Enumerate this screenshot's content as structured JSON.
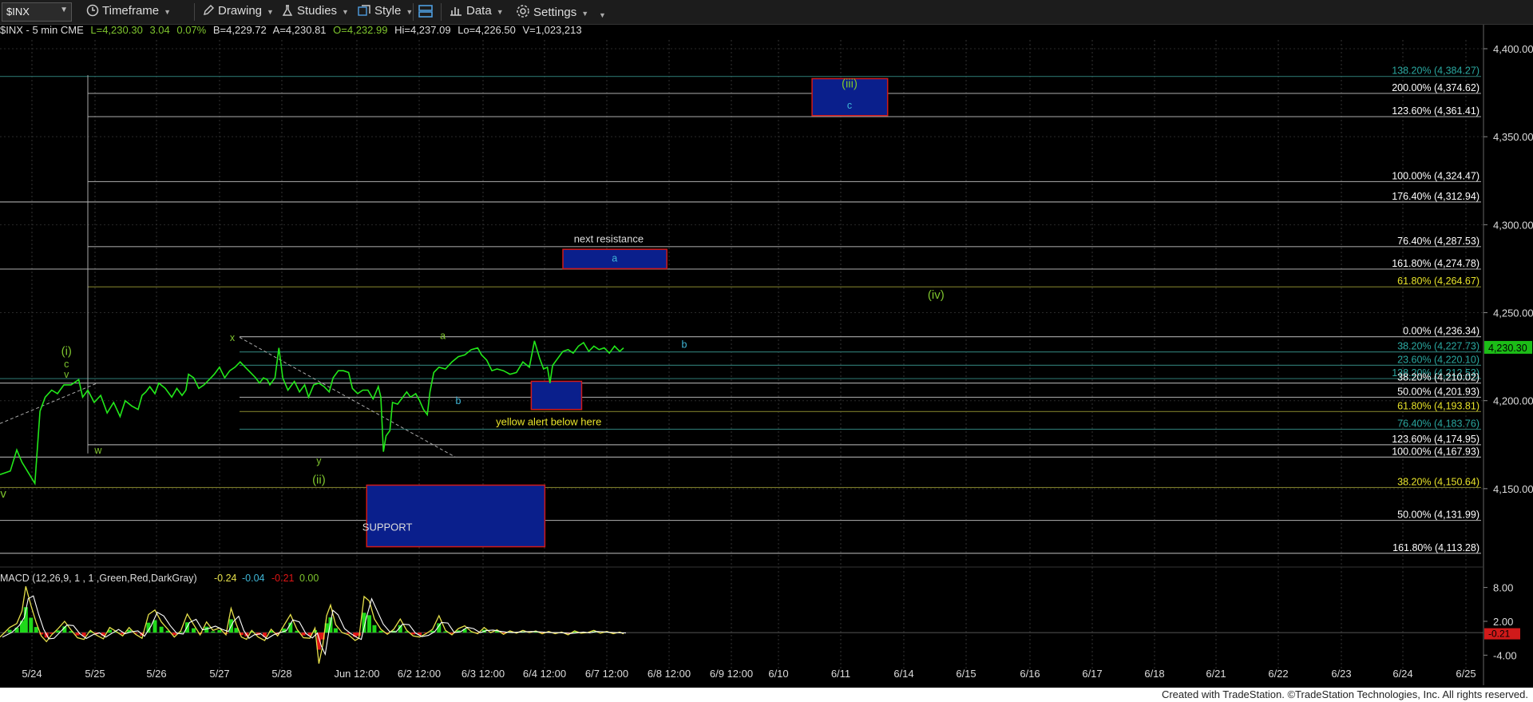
{
  "toolbar": {
    "symbol": "$INX",
    "timeframe": "Timeframe",
    "drawing": "Drawing",
    "studies": "Studies",
    "style": "Style",
    "data": "Data",
    "settings": "Settings"
  },
  "info": {
    "title": "$INX - 5 min  CME",
    "last": "L=4,230.30",
    "chg": "3.04",
    "pct": "0.07%",
    "bid": "B=4,229.72",
    "ask": "A=4,230.81",
    "open": "O=4,232.99",
    "high": "Hi=4,237.09",
    "low": "Lo=4,226.50",
    "vol": "V=1,023,213"
  },
  "colors": {
    "price": "#22e81a",
    "macd": "#e6e04a",
    "signal": "#ffffff",
    "hist_pos": "#1fd81a",
    "hist_neg": "#e01515",
    "box_fill": "#0a1f8c",
    "box_border": "#d01a1a",
    "label_green": "#7ec42e",
    "label_blue": "#3fb7d8",
    "label_yellow": "#e8e42a"
  },
  "chart_data": {
    "type": "line",
    "instrument": "$INX",
    "interval": "5 min",
    "y_ticks": [
      "4,400.00",
      "4,350.00",
      "4,300.00",
      "4,250.00",
      "4,200.00",
      "4,150.00"
    ],
    "ylim": [
      4110,
      4405
    ],
    "current_price": "4,230.30",
    "x_ticks": [
      "5/24",
      "5/25",
      "5/26",
      "5/27",
      "5/28",
      "Jun 12:00",
      "6/2 12:00",
      "6/3 12:00",
      "6/4 12:00",
      "6/7 12:00",
      "6/8 12:00",
      "6/9 12:00",
      "6/10",
      "6/11",
      "6/14",
      "6/15",
      "6/16",
      "6/17",
      "6/18",
      "6/21",
      "6/22",
      "6/23",
      "6/24",
      "6/25"
    ],
    "price_series": [
      [
        0.0,
        4158
      ],
      [
        1.6,
        4160
      ],
      [
        2.6,
        4172
      ],
      [
        3.4,
        4165
      ],
      [
        5.4,
        4153
      ],
      [
        6.2,
        4194
      ],
      [
        7.0,
        4202
      ],
      [
        8.0,
        4206
      ],
      [
        8.9,
        4204
      ],
      [
        9.9,
        4209
      ],
      [
        11.0,
        4209
      ],
      [
        12.2,
        4212
      ],
      [
        12.8,
        4202
      ],
      [
        13.6,
        4206
      ],
      [
        14.6,
        4199
      ],
      [
        15.6,
        4203
      ],
      [
        16.6,
        4193
      ],
      [
        17.6,
        4199
      ],
      [
        18.6,
        4191
      ],
      [
        19.4,
        4200
      ],
      [
        20.4,
        4197
      ],
      [
        21.4,
        4195
      ],
      [
        22.0,
        4203
      ],
      [
        22.6,
        4205
      ],
      [
        23.2,
        4208
      ],
      [
        24.0,
        4204
      ],
      [
        24.6,
        4210
      ],
      [
        25.6,
        4207
      ],
      [
        26.6,
        4202
      ],
      [
        27.4,
        4207
      ],
      [
        28.2,
        4203
      ],
      [
        28.8,
        4206
      ],
      [
        29.2,
        4215
      ],
      [
        30.0,
        4213
      ],
      [
        30.8,
        4207
      ],
      [
        31.6,
        4209
      ],
      [
        32.4,
        4212
      ],
      [
        33.2,
        4215
      ],
      [
        34.0,
        4219
      ],
      [
        34.8,
        4213
      ],
      [
        35.6,
        4217
      ],
      [
        36.4,
        4219
      ],
      [
        37.2,
        4222
      ],
      [
        38.0,
        4219
      ],
      [
        38.8,
        4216
      ],
      [
        39.6,
        4213
      ],
      [
        40.2,
        4210
      ],
      [
        40.8,
        4213
      ],
      [
        41.4,
        4212
      ],
      [
        41.8,
        4209
      ],
      [
        42.6,
        4213
      ],
      [
        43.2,
        4230
      ],
      [
        43.8,
        4213
      ],
      [
        44.6,
        4206
      ],
      [
        45.6,
        4211
      ],
      [
        46.4,
        4205
      ],
      [
        47.2,
        4209
      ],
      [
        47.8,
        4202
      ],
      [
        48.6,
        4209
      ],
      [
        49.4,
        4210
      ],
      [
        50.2,
        4208
      ],
      [
        51.0,
        4205
      ],
      [
        51.6,
        4213
      ],
      [
        52.4,
        4217
      ],
      [
        53.2,
        4217
      ],
      [
        54.0,
        4216
      ],
      [
        54.6,
        4207
      ],
      [
        55.4,
        4204
      ],
      [
        56.2,
        4206
      ],
      [
        57.0,
        4206
      ],
      [
        57.8,
        4201
      ],
      [
        58.6,
        4208
      ],
      [
        59.0,
        4202
      ],
      [
        59.4,
        4171
      ],
      [
        59.8,
        4180
      ],
      [
        60.4,
        4183
      ],
      [
        60.8,
        4199
      ],
      [
        61.6,
        4198
      ],
      [
        62.4,
        4202
      ],
      [
        63.0,
        4205
      ],
      [
        63.6,
        4202
      ],
      [
        64.4,
        4204
      ],
      [
        65.0,
        4200
      ],
      [
        65.6,
        4195
      ],
      [
        66.2,
        4192
      ],
      [
        66.6,
        4205
      ],
      [
        67.2,
        4216
      ],
      [
        68.0,
        4219
      ],
      [
        69.0,
        4218
      ],
      [
        70.0,
        4222
      ],
      [
        71.0,
        4225
      ],
      [
        72.0,
        4226
      ],
      [
        73.0,
        4229
      ],
      [
        74.0,
        4230
      ],
      [
        74.6,
        4226
      ],
      [
        75.4,
        4223
      ],
      [
        76.2,
        4217
      ],
      [
        77.0,
        4218
      ],
      [
        78.0,
        4217
      ],
      [
        79.0,
        4215
      ],
      [
        80.0,
        4216
      ],
      [
        81.0,
        4222
      ],
      [
        82.0,
        4219
      ],
      [
        82.8,
        4234
      ],
      [
        83.6,
        4224
      ],
      [
        84.2,
        4218
      ],
      [
        84.8,
        4219
      ],
      [
        85.2,
        4210
      ],
      [
        85.6,
        4220
      ],
      [
        86.4,
        4224
      ],
      [
        87.2,
        4228
      ],
      [
        88.0,
        4229
      ],
      [
        88.8,
        4227
      ],
      [
        89.6,
        4231
      ],
      [
        90.4,
        4233
      ],
      [
        91.2,
        4228
      ],
      [
        92.0,
        4231
      ],
      [
        92.8,
        4229
      ],
      [
        93.6,
        4230
      ],
      [
        94.4,
        4227
      ],
      [
        95.2,
        4231
      ],
      [
        96.0,
        4228
      ],
      [
        96.6,
        4230
      ]
    ],
    "fib_levels": [
      {
        "label": "138.20% (4,384.27)",
        "value": 4384.27,
        "color": "#2aa8a0"
      },
      {
        "label": "200.00% (4,374.62)",
        "value": 4374.62,
        "color": "#ffffff"
      },
      {
        "label": "123.60% (4,361.41)",
        "value": 4361.41,
        "color": "#ffffff"
      },
      {
        "label": "100.00% (4,324.47)",
        "value": 4324.47,
        "color": "#ffffff"
      },
      {
        "label": "176.40% (4,312.94)",
        "value": 4312.94,
        "color": "#ffffff"
      },
      {
        "label": "76.40% (4,287.53)",
        "value": 4287.53,
        "color": "#ffffff"
      },
      {
        "label": "161.80% (4,274.78)",
        "value": 4274.78,
        "color": "#ffffff"
      },
      {
        "label": "61.80% (4,264.67)",
        "value": 4264.67,
        "color": "#e8e42a"
      },
      {
        "label": "0.00% (4,236.34)",
        "value": 4236.34,
        "color": "#ffffff"
      },
      {
        "label": "38.20% (4,227.73)",
        "value": 4227.73,
        "color": "#2aa8a0"
      },
      {
        "label": "23.60% (4,220.10)",
        "value": 4220.1,
        "color": "#2aa8a0"
      },
      {
        "label": "138.20% (4,212.53)",
        "value": 4212.53,
        "color": "#2aa8a0"
      },
      {
        "label": "38.20% (4,210.02)",
        "value": 4210.02,
        "color": "#ffffff"
      },
      {
        "label": "50.00% (4,201.93)",
        "value": 4201.93,
        "color": "#ffffff"
      },
      {
        "label": "61.80% (4,193.81)",
        "value": 4193.81,
        "color": "#e8e42a"
      },
      {
        "label": "76.40% (4,183.76)",
        "value": 4183.76,
        "color": "#2aa8a0"
      },
      {
        "label": "123.60% (4,174.95)",
        "value": 4174.95,
        "color": "#ffffff"
      },
      {
        "label": "100.00% (4,167.93)",
        "value": 4167.93,
        "color": "#ffffff"
      },
      {
        "label": "38.20% (4,150.64)",
        "value": 4150.64,
        "color": "#e8e42a"
      },
      {
        "label": "50.00% (4,131.99)",
        "value": 4131.99,
        "color": "#ffffff"
      },
      {
        "label": "161.80% (4,113.28)",
        "value": 4113.28,
        "color": "#ffffff"
      }
    ],
    "zones": [
      {
        "name": "zone-iii-c",
        "x": [
          125.8,
          137.5
        ],
        "y": [
          4362,
          4383
        ]
      },
      {
        "name": "zone-next-resistance",
        "x": [
          87.2,
          103.3
        ],
        "y": [
          4275,
          4286
        ]
      },
      {
        "name": "zone-b",
        "x": [
          82.3,
          90.1
        ],
        "y": [
          4195,
          4211
        ]
      },
      {
        "name": "zone-support",
        "x": [
          56.8,
          84.4
        ],
        "y": [
          4117,
          4152
        ]
      }
    ],
    "wave_labels": [
      {
        "text": "(i)",
        "x": 10.3,
        "y": 4226,
        "color": "#7ec42e"
      },
      {
        "text": "c",
        "x": 10.3,
        "y": 4219,
        "color": "#7ec42e"
      },
      {
        "text": "v",
        "x": 10.3,
        "y": 4213,
        "color": "#7ec42e"
      },
      {
        "text": "iv",
        "x": 0.3,
        "y": 4145,
        "color": "#7ec42e"
      },
      {
        "text": "w",
        "x": 15.2,
        "y": 4170,
        "color": "#7ec42e"
      },
      {
        "text": "x",
        "x": 36.0,
        "y": 4234,
        "color": "#7ec42e"
      },
      {
        "text": "y",
        "x": 49.4,
        "y": 4164,
        "color": "#7ec42e"
      },
      {
        "text": "(ii)",
        "x": 49.4,
        "y": 4153,
        "color": "#7ec42e"
      },
      {
        "text": "a",
        "x": 68.6,
        "y": 4235,
        "color": "#7ec42e"
      },
      {
        "text": "b",
        "x": 71.0,
        "y": 4198,
        "color": "#3fb7d8"
      },
      {
        "text": "(iii)",
        "x": 131.6,
        "y": 4378,
        "color": "#7ec42e"
      },
      {
        "text": "c",
        "x": 131.6,
        "y": 4366,
        "color": "#3fb7d8"
      },
      {
        "text": "a",
        "x": 95.2,
        "y": 4279,
        "color": "#3fb7d8"
      },
      {
        "text": "(iv)",
        "x": 145.0,
        "y": 4258,
        "color": "#7ec42e"
      },
      {
        "text": "b",
        "x": 106.0,
        "y": 4230,
        "color": "#3fb7d8"
      }
    ],
    "annotations": [
      {
        "text": "next resistance",
        "x": 94.3,
        "y": 4290,
        "color": "#dddddd"
      },
      {
        "text": "yellow alert below here",
        "x": 85.0,
        "y": 4186,
        "color": "#e8e42a"
      },
      {
        "text": "SUPPORT",
        "x": 60.0,
        "y": 4126,
        "color": "#dddddd"
      }
    ],
    "macd": {
      "label": "MACD (12,26,9, 1 , 1 ,Green,Red,DarkGray)",
      "macd_value": "-0.24",
      "signal_value": "-0.04",
      "diff_value": "-0.21",
      "zero_value": "0.00",
      "y_ticks": [
        "8.00",
        "2.00",
        "-4.00"
      ],
      "ylim": [
        -6.5,
        9.5
      ],
      "current": "-0.21",
      "series": [
        [
          0.0,
          -0.8
        ],
        [
          1.5,
          0.9
        ],
        [
          2.6,
          1.6
        ],
        [
          3.4,
          3.8
        ],
        [
          4.0,
          8.2
        ],
        [
          4.8,
          4.8
        ],
        [
          5.6,
          1.8
        ],
        [
          6.4,
          -0.6
        ],
        [
          7.2,
          -1.6
        ],
        [
          8.0,
          -0.4
        ],
        [
          9.0,
          0.7
        ],
        [
          10.0,
          2.0
        ],
        [
          11.0,
          0.5
        ],
        [
          12.0,
          -0.9
        ],
        [
          13.0,
          -1.2
        ],
        [
          14.0,
          0.4
        ],
        [
          15.0,
          -0.5
        ],
        [
          16.0,
          -1.1
        ],
        [
          17.0,
          0.9
        ],
        [
          18.0,
          0.2
        ],
        [
          19.0,
          -0.6
        ],
        [
          20.0,
          0.9
        ],
        [
          21.0,
          -0.3
        ],
        [
          22.0,
          -1.0
        ],
        [
          23.0,
          3.2
        ],
        [
          24.0,
          4.0
        ],
        [
          25.0,
          1.9
        ],
        [
          26.0,
          0.6
        ],
        [
          27.0,
          -0.8
        ],
        [
          28.0,
          0.3
        ],
        [
          29.0,
          3.3
        ],
        [
          30.0,
          1.4
        ],
        [
          31.0,
          -0.4
        ],
        [
          32.0,
          1.9
        ],
        [
          33.0,
          0.4
        ],
        [
          34.0,
          0.8
        ],
        [
          35.0,
          -0.4
        ],
        [
          35.8,
          4.3
        ],
        [
          36.6,
          1.5
        ],
        [
          37.4,
          -0.8
        ],
        [
          38.2,
          -1.2
        ],
        [
          39.0,
          0.4
        ],
        [
          40.0,
          -0.8
        ],
        [
          41.0,
          -1.4
        ],
        [
          42.0,
          0.6
        ],
        [
          43.0,
          -0.6
        ],
        [
          44.0,
          1.3
        ],
        [
          45.0,
          3.2
        ],
        [
          46.0,
          0.6
        ],
        [
          47.0,
          -0.9
        ],
        [
          48.0,
          -1.0
        ],
        [
          48.8,
          0.8
        ],
        [
          49.4,
          -5.5
        ],
        [
          50.0,
          -2.2
        ],
        [
          50.6,
          3.0
        ],
        [
          51.2,
          4.9
        ],
        [
          52.0,
          1.4
        ],
        [
          53.0,
          0.0
        ],
        [
          54.0,
          -0.4
        ],
        [
          55.0,
          -1.4
        ],
        [
          55.6,
          -1.0
        ],
        [
          56.4,
          6.4
        ],
        [
          57.2,
          5.6
        ],
        [
          58.0,
          2.4
        ],
        [
          59.0,
          0.6
        ],
        [
          60.0,
          -0.3
        ],
        [
          61.0,
          0.6
        ],
        [
          62.0,
          2.4
        ],
        [
          63.0,
          0.4
        ],
        [
          64.0,
          -0.6
        ],
        [
          65.0,
          -0.8
        ],
        [
          66.0,
          -0.2
        ],
        [
          67.0,
          0.6
        ],
        [
          68.0,
          3.0
        ],
        [
          69.0,
          0.4
        ],
        [
          70.0,
          -0.4
        ],
        [
          71.0,
          0.7
        ],
        [
          72.0,
          1.2
        ],
        [
          73.0,
          0.2
        ],
        [
          74.0,
          -0.2
        ],
        [
          75.0,
          0.9
        ],
        [
          76.0,
          0.0
        ],
        [
          77.0,
          0.5
        ],
        [
          78.0,
          -0.3
        ],
        [
          79.0,
          0.3
        ],
        [
          80.0,
          -0.1
        ],
        [
          81.0,
          0.4
        ],
        [
          82.0,
          0.0
        ],
        [
          83.0,
          0.3
        ],
        [
          84.0,
          -0.2
        ],
        [
          85.0,
          0.2
        ],
        [
          86.0,
          -0.2
        ],
        [
          87.0,
          0.1
        ],
        [
          88.0,
          -0.4
        ],
        [
          89.0,
          0.3
        ],
        [
          90.0,
          -0.1
        ],
        [
          91.0,
          0.0
        ],
        [
          92.0,
          0.4
        ],
        [
          93.0,
          -0.1
        ],
        [
          94.0,
          0.2
        ],
        [
          95.0,
          -0.2
        ],
        [
          96.0,
          0.1
        ],
        [
          96.6,
          -0.21
        ]
      ]
    }
  },
  "footer": "Created with TradeStation. ©TradeStation Technologies, Inc. All rights reserved."
}
